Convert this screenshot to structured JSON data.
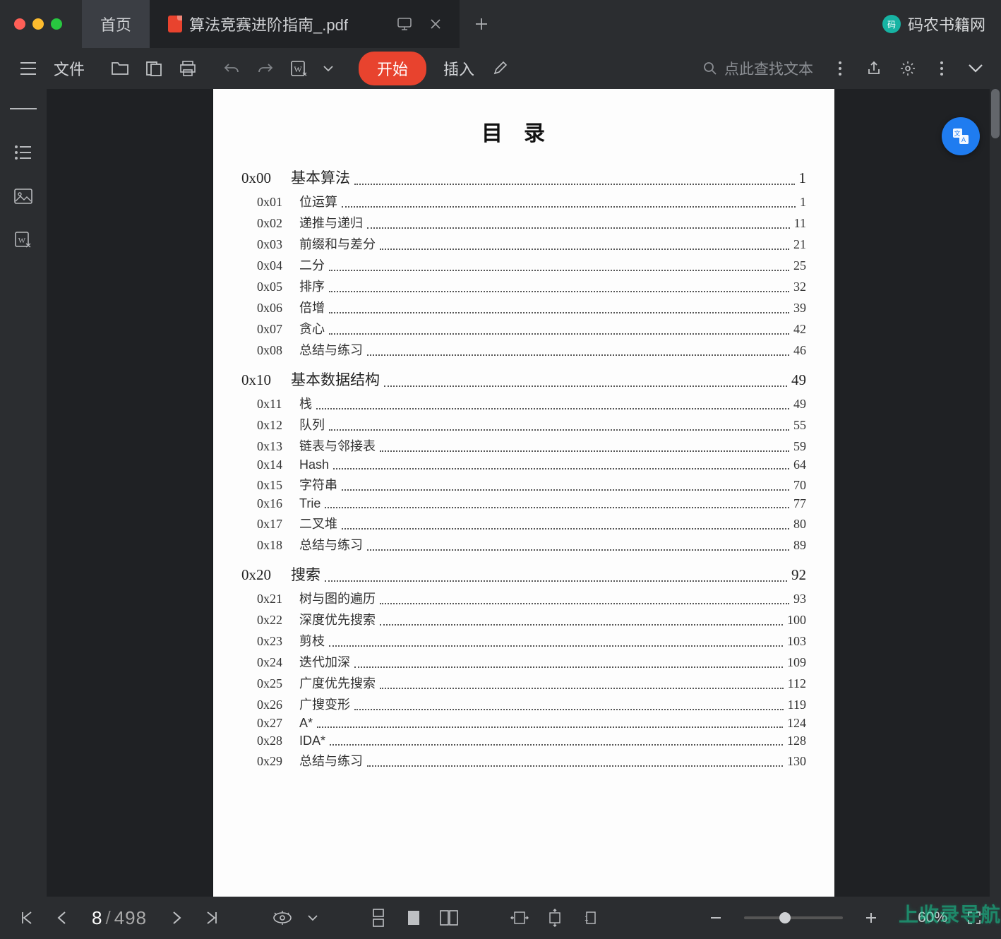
{
  "titlebar": {
    "home_tab": "首页",
    "doc_tab": "算法竞赛进阶指南_.pdf",
    "brand": "码农书籍网",
    "brand_badge": "码"
  },
  "toolbar": {
    "file": "文件",
    "start": "开始",
    "insert": "插入",
    "search_placeholder": "点此查找文本"
  },
  "doc": {
    "title": "目录",
    "toc": [
      {
        "level": 0,
        "code": "0x00",
        "title": "基本算法",
        "page": "1"
      },
      {
        "level": 1,
        "code": "0x01",
        "title": "位运算",
        "page": "1"
      },
      {
        "level": 1,
        "code": "0x02",
        "title": "递推与递归",
        "page": "11"
      },
      {
        "level": 1,
        "code": "0x03",
        "title": "前缀和与差分",
        "page": "21"
      },
      {
        "level": 1,
        "code": "0x04",
        "title": "二分",
        "page": "25"
      },
      {
        "level": 1,
        "code": "0x05",
        "title": "排序",
        "page": "32"
      },
      {
        "level": 1,
        "code": "0x06",
        "title": "倍增",
        "page": "39"
      },
      {
        "level": 1,
        "code": "0x07",
        "title": "贪心",
        "page": "42"
      },
      {
        "level": 1,
        "code": "0x08",
        "title": "总结与练习",
        "page": "46"
      },
      {
        "level": 0,
        "code": "0x10",
        "title": "基本数据结构",
        "page": "49"
      },
      {
        "level": 1,
        "code": "0x11",
        "title": "栈",
        "page": "49"
      },
      {
        "level": 1,
        "code": "0x12",
        "title": "队列",
        "page": "55"
      },
      {
        "level": 1,
        "code": "0x13",
        "title": "链表与邻接表",
        "page": "59"
      },
      {
        "level": 1,
        "code": "0x14",
        "title": "Hash",
        "page": "64"
      },
      {
        "level": 1,
        "code": "0x15",
        "title": "字符串",
        "page": "70"
      },
      {
        "level": 1,
        "code": "0x16",
        "title": "Trie",
        "page": "77"
      },
      {
        "level": 1,
        "code": "0x17",
        "title": "二叉堆",
        "page": "80"
      },
      {
        "level": 1,
        "code": "0x18",
        "title": "总结与练习",
        "page": "89"
      },
      {
        "level": 0,
        "code": "0x20",
        "title": "搜索",
        "page": "92"
      },
      {
        "level": 1,
        "code": "0x21",
        "title": "树与图的遍历",
        "page": "93"
      },
      {
        "level": 1,
        "code": "0x22",
        "title": "深度优先搜索",
        "page": "100"
      },
      {
        "level": 1,
        "code": "0x23",
        "title": "剪枝",
        "page": "103"
      },
      {
        "level": 1,
        "code": "0x24",
        "title": "迭代加深",
        "page": "109"
      },
      {
        "level": 1,
        "code": "0x25",
        "title": "广度优先搜索",
        "page": "112"
      },
      {
        "level": 1,
        "code": "0x26",
        "title": "广搜变形",
        "page": "119"
      },
      {
        "level": 1,
        "code": "0x27",
        "title": "A*",
        "page": "124"
      },
      {
        "level": 1,
        "code": "0x28",
        "title": "IDA*",
        "page": "128"
      },
      {
        "level": 1,
        "code": "0x29",
        "title": "总结与练习",
        "page": "130"
      }
    ]
  },
  "status": {
    "page_current": "8",
    "page_total": "498",
    "zoom": "60%",
    "zoom_thumb_pct": 40
  },
  "watermark": "上收录导航"
}
